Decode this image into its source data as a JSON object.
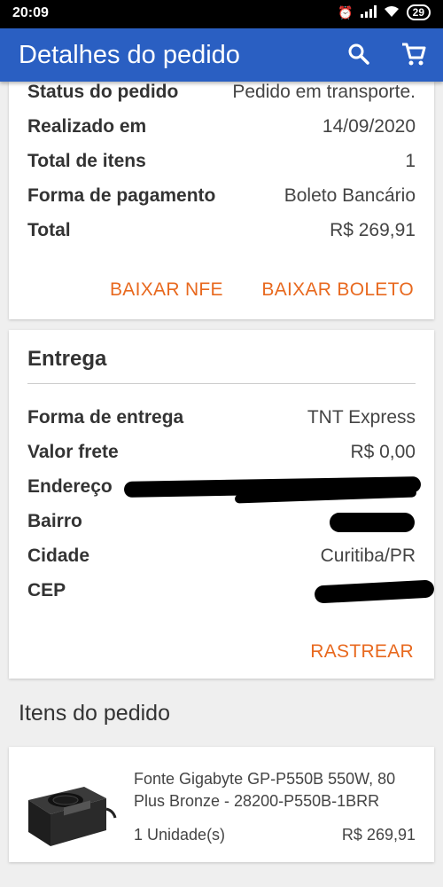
{
  "status_bar": {
    "time": "20:09",
    "battery": "29"
  },
  "app_bar": {
    "title": "Detalhes do pedido",
    "search_icon": "search-icon",
    "cart_icon": "cart-icon"
  },
  "order": {
    "rows": [
      {
        "label": "Status do pedido",
        "value": "Pedido em transporte."
      },
      {
        "label": "Realizado em",
        "value": "14/09/2020"
      },
      {
        "label": "Total de itens",
        "value": "1"
      },
      {
        "label": "Forma de pagamento",
        "value": "Boleto Bancário"
      },
      {
        "label": "Total",
        "value": "R$ 269,91"
      }
    ],
    "btn_nfe": "BAIXAR NFE",
    "btn_boleto": "BAIXAR BOLETO"
  },
  "delivery": {
    "title": "Entrega",
    "rows": [
      {
        "label": "Forma de entrega",
        "value": "TNT Express"
      },
      {
        "label": "Valor frete",
        "value": "R$ 0,00"
      },
      {
        "label": "Endereço",
        "value": ""
      },
      {
        "label": "Bairro",
        "value": ""
      },
      {
        "label": "Cidade",
        "value": "Curitiba/PR"
      },
      {
        "label": "CEP",
        "value": ""
      }
    ],
    "btn_track": "RASTREAR"
  },
  "items": {
    "title": "Itens do pedido",
    "list": [
      {
        "name": "Fonte Gigabyte GP-P550B 550W, 80 Plus Bronze - 28200-P550B-1BRR",
        "quantity": "1 Unidade(s)",
        "price": "R$ 269,91"
      }
    ]
  },
  "colors": {
    "app_bar": "#2a5fc2",
    "accent": "#e8691f",
    "background": "#efefef"
  }
}
